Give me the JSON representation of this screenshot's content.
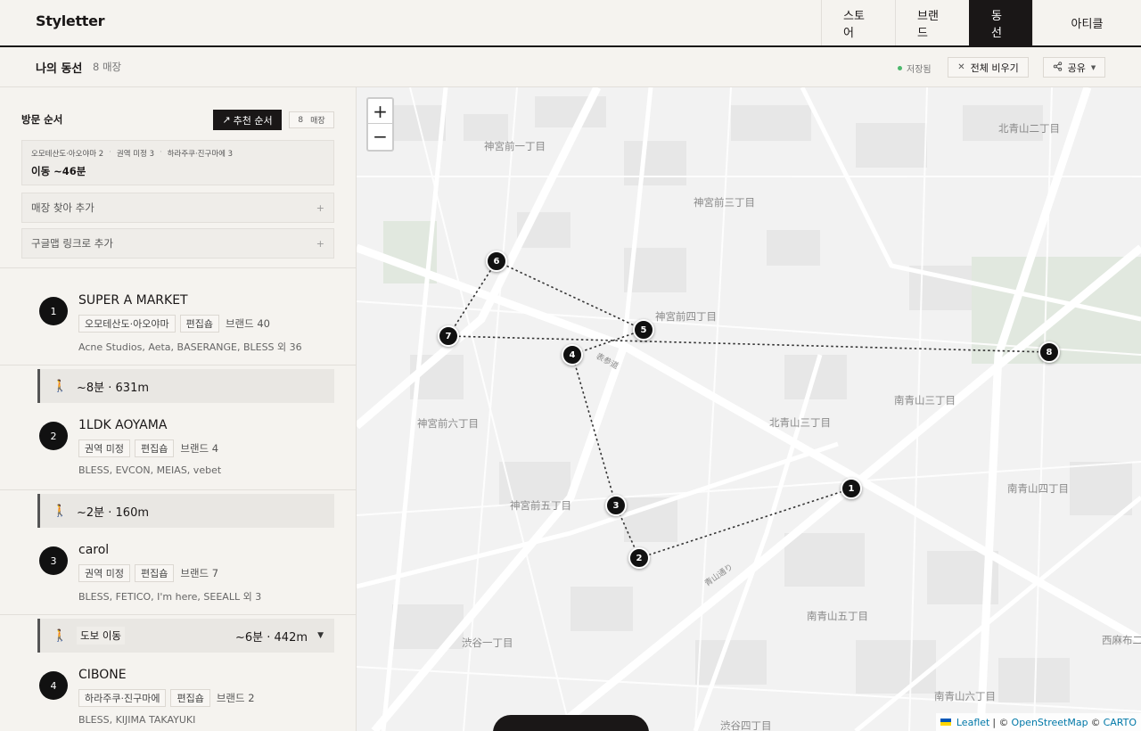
{
  "app": {
    "logo": "Styletter"
  },
  "nav": {
    "tabs": [
      "스토어",
      "브랜드",
      "동선",
      "아티클"
    ],
    "active": "동선"
  },
  "subheader": {
    "title": "나의 동선",
    "count": "8 매장",
    "saved": "저장됨",
    "clear_label": "전체 비우기",
    "share_label": "공유"
  },
  "panel": {
    "visit_label": "방문 순서",
    "recommend_label": "추천 순서",
    "store_count_num": "8",
    "store_count_unit": "매장",
    "summary": {
      "areas": [
        "오모테산도·아오야마 2",
        "권역 미정 3",
        "하라주쿠·진구마에 3"
      ],
      "travel": "이동 ~46분"
    },
    "add_search": "매장 찾아 추가",
    "add_google": "구글맵 링크로 추가"
  },
  "stores": [
    {
      "num": "1",
      "name": "SUPER A MARKET",
      "area": "오모테산도·아오야마",
      "type": "편집숍",
      "brand_count": "브랜드 40",
      "brands": "Acne Studios, Aeta, BASERANGE, BLESS 외 36"
    },
    {
      "num": "2",
      "name": "1LDK AOYAMA",
      "area": "권역 미정",
      "type": "편집숍",
      "brand_count": "브랜드 4",
      "brands": "BLESS, EVCON, MEIAS, vebet"
    },
    {
      "num": "3",
      "name": "carol",
      "area": "권역 미정",
      "type": "편집숍",
      "brand_count": "브랜드 7",
      "brands": "BLESS, FETICO, I'm here, SEEALL 외 3"
    },
    {
      "num": "4",
      "name": "CIBONE",
      "area": "하라주쿠·진구마에",
      "type": "편집숍",
      "brand_count": "브랜드 2",
      "brands": "BLESS, KIJIMA TAKAYUKI"
    }
  ],
  "legs": [
    {
      "dist": "~8분 · 631m"
    },
    {
      "dist": "~2분 · 160m"
    },
    {
      "mode": "도보 이동",
      "dist": "~6분 · 442m"
    }
  ],
  "map": {
    "zoom_in": "+",
    "zoom_out": "−",
    "pins": [
      "1",
      "2",
      "3",
      "4",
      "5",
      "6",
      "7",
      "8"
    ],
    "labels": [
      "神宮前一丁目",
      "北青山二丁目",
      "神宮前三丁目",
      "神宮前四丁目",
      "南青山三丁目",
      "北青山三丁目",
      "神宮前六丁目",
      "神宮前五丁目",
      "南青山四丁目",
      "南青山五丁目",
      "渋谷一丁目",
      "西麻布二",
      "南青山六丁目",
      "渋谷四丁目",
      "表参道",
      "青山通り"
    ],
    "attribution": {
      "leaflet": "Leaflet",
      "osm": "OpenStreetMap",
      "carto": "CARTO"
    }
  }
}
